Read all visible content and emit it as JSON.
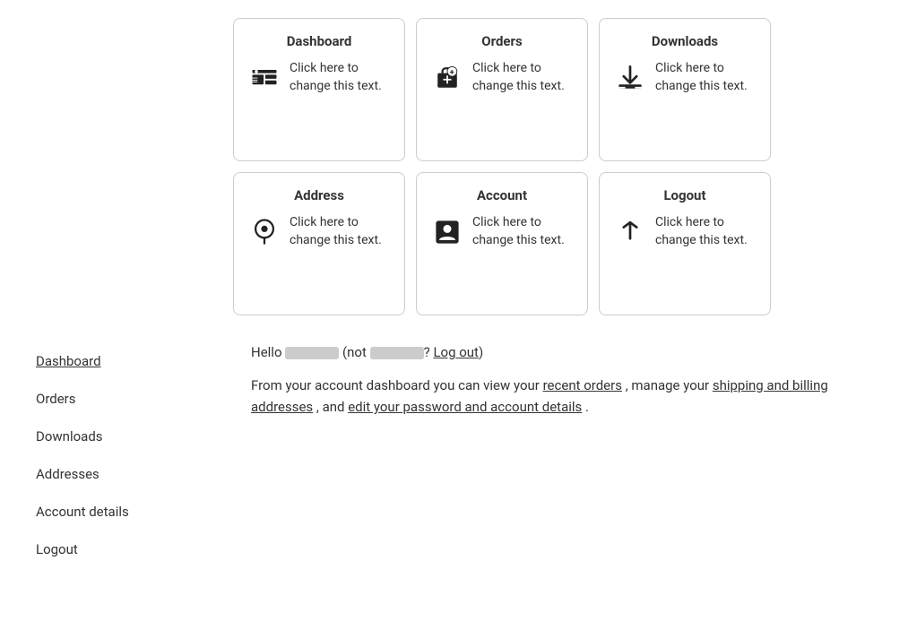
{
  "cards": [
    {
      "id": "dashboard",
      "title": "Dashboard",
      "text": "Click here to change this text.",
      "icon": "dashboard"
    },
    {
      "id": "orders",
      "title": "Orders",
      "text": "Click here to change this text.",
      "icon": "orders"
    },
    {
      "id": "downloads",
      "title": "Downloads",
      "text": "Click here to change this text.",
      "icon": "downloads"
    },
    {
      "id": "address",
      "title": "Address",
      "text": "Click here to change this text.",
      "icon": "address"
    },
    {
      "id": "account",
      "title": "Account",
      "text": "Click here to change this text.",
      "icon": "account"
    },
    {
      "id": "logout",
      "title": "Logout",
      "text": "Click here to change this text.",
      "icon": "logout"
    }
  ],
  "sidebar": {
    "items": [
      {
        "label": "Dashboard",
        "active": true,
        "href": "#"
      },
      {
        "label": "Orders",
        "active": false,
        "href": "#"
      },
      {
        "label": "Downloads",
        "active": false,
        "href": "#"
      },
      {
        "label": "Addresses",
        "active": false,
        "href": "#"
      },
      {
        "label": "Account details",
        "active": false,
        "href": "#"
      },
      {
        "label": "Logout",
        "active": false,
        "href": "#"
      }
    ]
  },
  "main": {
    "hello_prefix": "Hello",
    "hello_not": "(not",
    "hello_suffix": "?",
    "log_out_label": "Log out",
    "close_paren": ")",
    "desc_prefix": "From your account dashboard you can view your",
    "desc_link1": "recent orders",
    "desc_mid1": ", manage your",
    "desc_link2": "shipping and billing addresses",
    "desc_mid2": ", and",
    "desc_link3": "edit your password and account details",
    "desc_end": "."
  }
}
